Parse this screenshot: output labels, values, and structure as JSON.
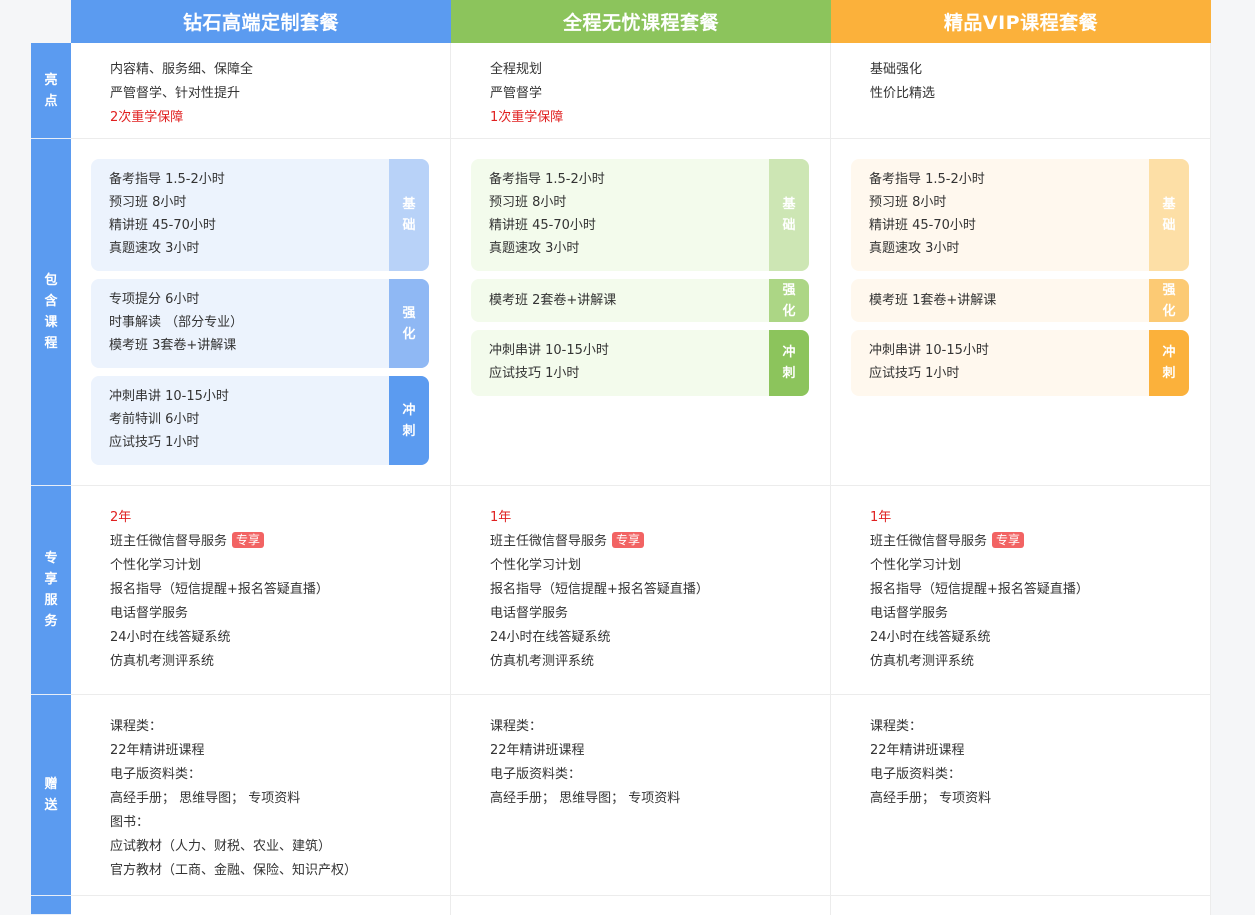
{
  "packages": [
    {
      "title": "钻石高端定制套餐",
      "highlights": [
        "内容精、服务细、保障全",
        "严管督学、针对性提升",
        "2次重学保障"
      ],
      "courses": {
        "base": [
          "备考指导 1.5-2小时",
          "预习班 8小时",
          "精讲班 45-70小时",
          "真题速攻 3小时"
        ],
        "strengthen": [
          "专项提分 6小时",
          "时事解读 （部分专业）",
          "模考班 3套卷+讲解课"
        ],
        "sprint": [
          "冲刺串讲 10-15小时",
          "考前特训 6小时",
          "应试技巧 1小时"
        ]
      },
      "services": {
        "duration": "2年",
        "wechat": "班主任微信督导服务",
        "items": [
          "个性化学习计划",
          "报名指导（短信提醒+报名答疑直播）",
          "电话督学服务",
          "24小时在线答疑系统",
          "仿真机考测评系统"
        ]
      },
      "gifts": [
        "课程类：",
        "22年精讲班课程",
        "电子版资料类：",
        "高经手册； 思维导图； 专项资料",
        "图书：",
        "应试教材（人力、财税、农业、建筑）",
        "官方教材（工商、金融、保险、知识产权）"
      ]
    },
    {
      "title": "全程无忧课程套餐",
      "highlights": [
        "全程规划",
        "严管督学",
        "1次重学保障"
      ],
      "courses": {
        "base": [
          "备考指导 1.5-2小时",
          "预习班 8小时",
          "精讲班 45-70小时",
          "真题速攻 3小时"
        ],
        "strengthen": [
          "模考班 2套卷+讲解课"
        ],
        "sprint": [
          "冲刺串讲 10-15小时",
          "应试技巧 1小时"
        ]
      },
      "services": {
        "duration": "1年",
        "wechat": "班主任微信督导服务",
        "items": [
          "个性化学习计划",
          "报名指导（短信提醒+报名答疑直播）",
          "电话督学服务",
          "24小时在线答疑系统",
          "仿真机考测评系统"
        ]
      },
      "gifts": [
        "课程类：",
        "22年精讲班课程",
        "电子版资料类：",
        "高经手册； 思维导图； 专项资料"
      ]
    },
    {
      "title": "精品VIP课程套餐",
      "highlights": [
        "基础强化",
        "性价比精选"
      ],
      "courses": {
        "base": [
          "备考指导 1.5-2小时",
          "预习班 8小时",
          "精讲班 45-70小时",
          "真题速攻 3小时"
        ],
        "strengthen": [
          "模考班 1套卷+讲解课"
        ],
        "sprint": [
          "冲刺串讲 10-15小时",
          "应试技巧 1小时"
        ]
      },
      "services": {
        "duration": "1年",
        "wechat": "班主任微信督导服务",
        "items": [
          "个性化学习计划",
          "报名指导（短信提醒+报名答疑直播）",
          "电话督学服务",
          "24小时在线答疑系统",
          "仿真机考测评系统"
        ]
      },
      "gifts": [
        "课程类：",
        "22年精讲班课程",
        "电子版资料类：",
        "高经手册； 专项资料"
      ]
    }
  ],
  "row_labels": {
    "highlights": "亮点",
    "courses": "包含课程",
    "services": "专享服务",
    "gifts": "赠送"
  },
  "stage_labels": {
    "base": "基础",
    "strengthen": "强化",
    "sprint": "冲刺"
  },
  "exclusive_badge": "专享",
  "colors": {
    "diamond": "#5b9bf0",
    "worry_free": "#8cc45c",
    "vip": "#fbb13b",
    "red_text": "#e02020",
    "badge": "#f26363"
  }
}
